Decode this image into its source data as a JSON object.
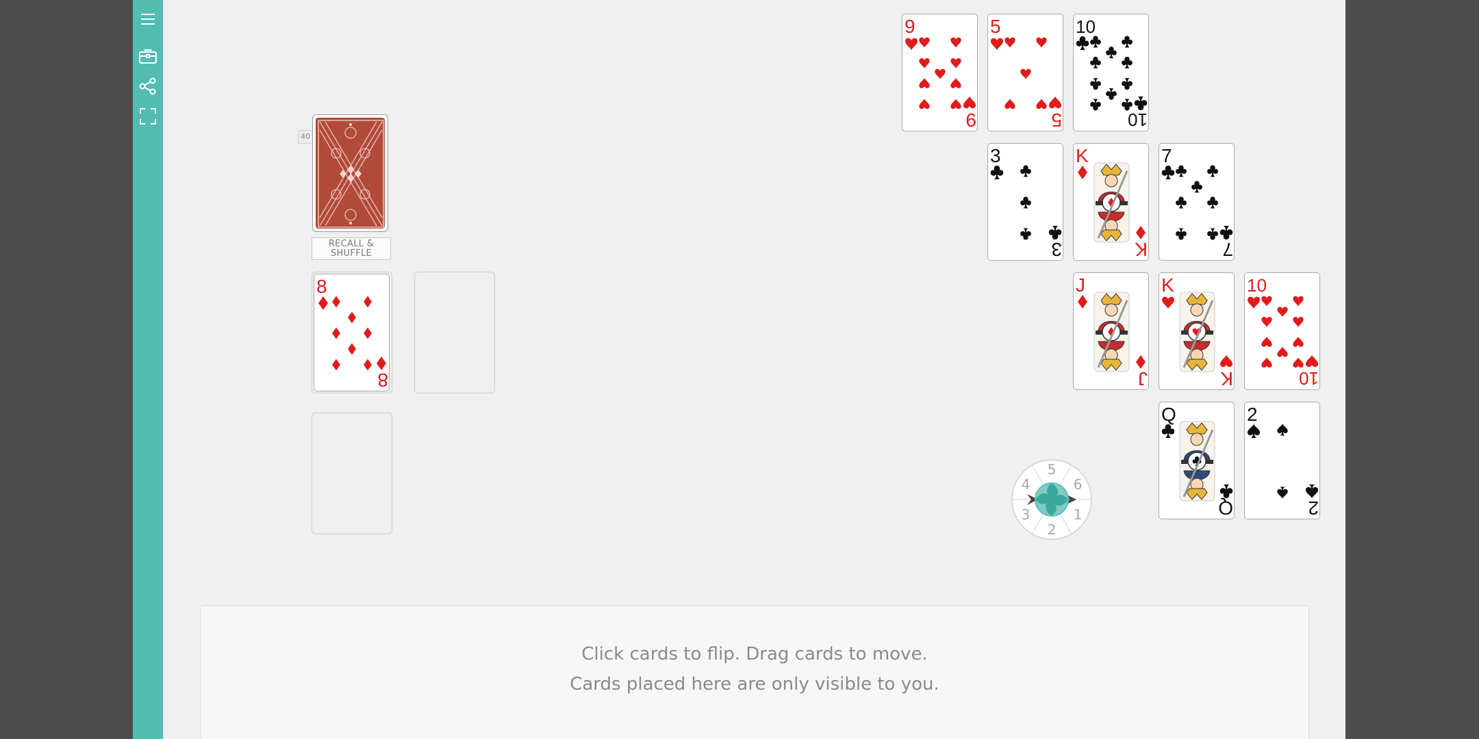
{
  "sidebar": {
    "items": [
      {
        "name": "menu-icon"
      },
      {
        "name": "toolbox-icon"
      },
      {
        "name": "share-icon"
      },
      {
        "name": "fullscreen-icon"
      }
    ]
  },
  "deck": {
    "count": "40",
    "recall_label_line1": "RECALL &",
    "recall_label_line2": "SHUFFLE"
  },
  "cards": [
    {
      "rank": "9",
      "suit": "hearts"
    },
    {
      "rank": "5",
      "suit": "hearts"
    },
    {
      "rank": "10",
      "suit": "clubs"
    },
    {
      "rank": "3",
      "suit": "clubs"
    },
    {
      "rank": "K",
      "suit": "diamonds"
    },
    {
      "rank": "7",
      "suit": "clubs"
    },
    {
      "rank": "J",
      "suit": "diamonds"
    },
    {
      "rank": "K",
      "suit": "hearts"
    },
    {
      "rank": "10",
      "suit": "hearts"
    },
    {
      "rank": "Q",
      "suit": "clubs"
    },
    {
      "rank": "2",
      "suit": "spades"
    },
    {
      "rank": "8",
      "suit": "diamonds"
    }
  ],
  "dial": {
    "numbers": [
      "5",
      "6",
      "1",
      "2",
      "3",
      "4"
    ]
  },
  "private_area": {
    "line1": "Click cards to flip.   Drag cards to move.",
    "line2": "Cards placed here are only visible to you."
  },
  "colors": {
    "sidebar": "#52bcb1",
    "table": "#f0f0f0",
    "red_suit": "#e01b1b",
    "black_suit": "#111111",
    "card_back": "#b24a3a"
  }
}
